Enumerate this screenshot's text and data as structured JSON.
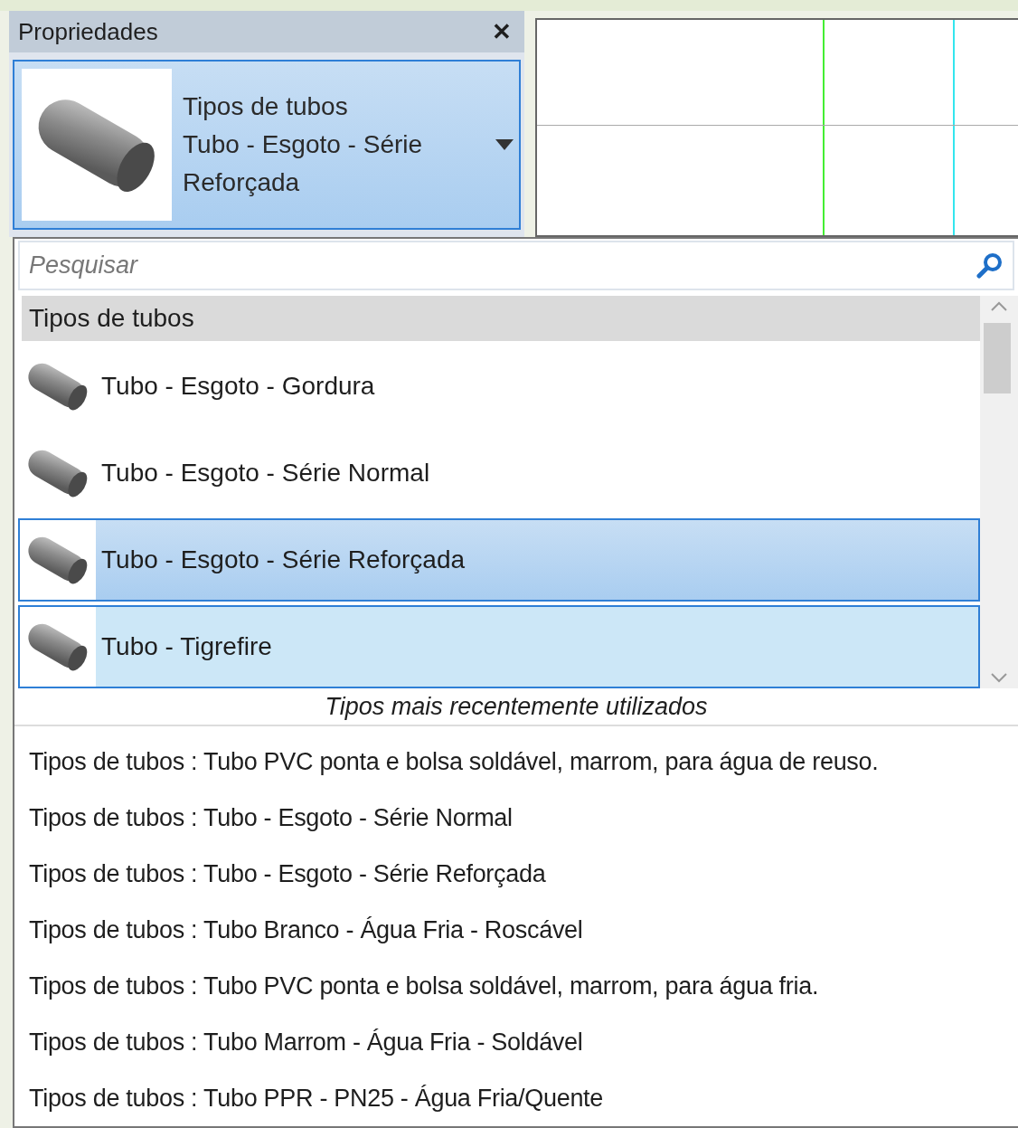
{
  "panel": {
    "title": "Propriedades",
    "close": "✕"
  },
  "type_selector": {
    "family": "Tipos de tubos",
    "type_lines": [
      "Tubo - Esgoto - Série",
      "Reforçada"
    ]
  },
  "search": {
    "placeholder": "Pesquisar"
  },
  "type_list": {
    "category": "Tipos de tubos",
    "items": [
      {
        "label": "Tubo - Esgoto - Gordura",
        "selected": false,
        "hovered": false
      },
      {
        "label": "Tubo - Esgoto - Série Normal",
        "selected": false,
        "hovered": false
      },
      {
        "label": "Tubo - Esgoto - Série Reforçada",
        "selected": true,
        "hovered": false
      },
      {
        "label": "Tubo - Tigrefire",
        "selected": false,
        "hovered": true
      }
    ]
  },
  "recent": {
    "title": "Tipos mais recentemente utilizados",
    "items": [
      "Tipos de tubos : Tubo PVC ponta e bolsa soldável, marrom, para água de reuso.",
      "Tipos de tubos : Tubo - Esgoto - Série Normal",
      "Tipos de tubos : Tubo - Esgoto - Série Reforçada",
      "Tipos de tubos : Tubo Branco - Água Fria - Roscável",
      "Tipos de tubos : Tubo PVC ponta e bolsa soldável, marrom, para água fria.",
      "Tipos de tubos : Tubo Marrom - Água Fria - Soldável",
      "Tipos de tubos : Tubo PPR - PN25 - Água Fria/Quente"
    ]
  }
}
